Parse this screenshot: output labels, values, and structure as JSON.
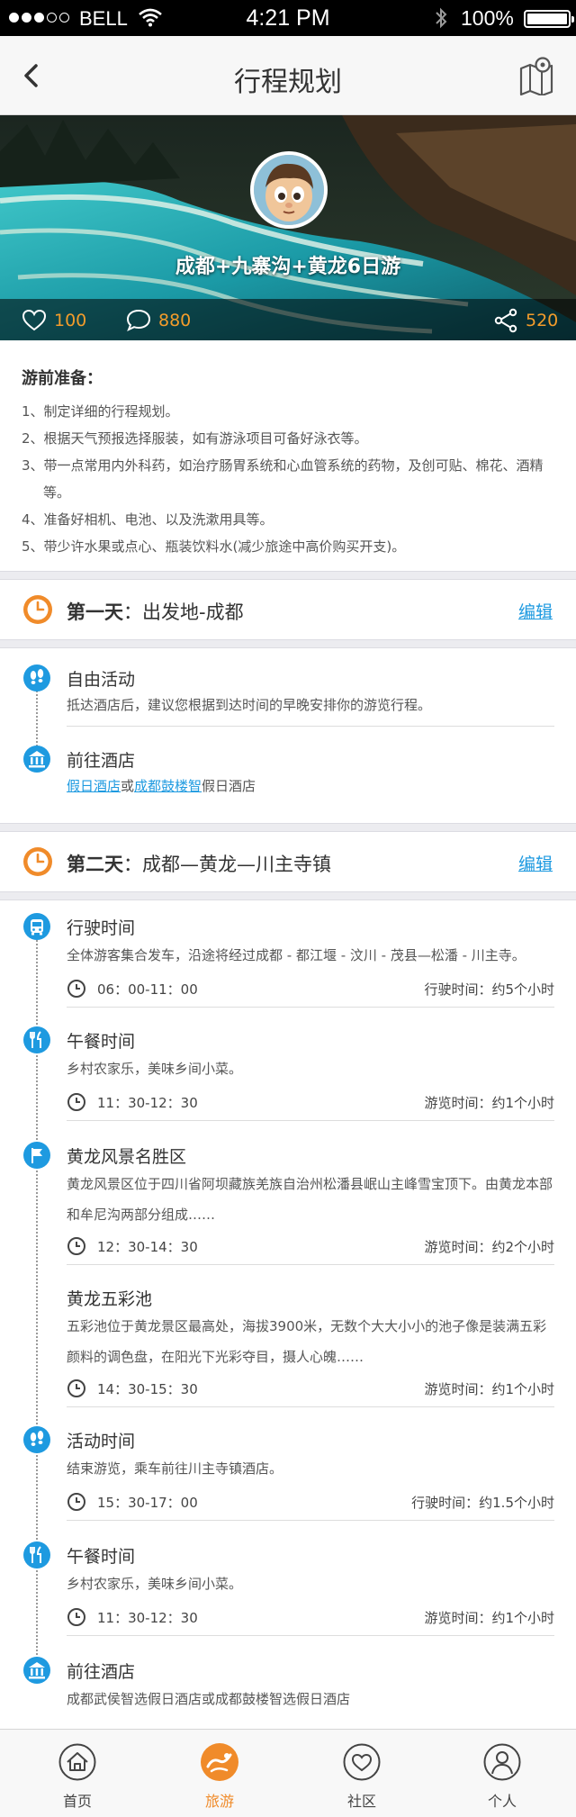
{
  "status_bar": {
    "carrier": "BELL",
    "time": "4:21 PM",
    "battery": "100%"
  },
  "nav": {
    "title": "行程规划",
    "back_icon": "chevron-left-icon",
    "map_icon": "map-pin-icon"
  },
  "hero": {
    "title": "成都+九寨沟+黄龙6日游",
    "likes": "100",
    "comments": "880",
    "shares": "520"
  },
  "prep": {
    "title": "游前准备：",
    "items": [
      "1、制定详细的行程规划。",
      "2、根据天气预报选择服装，如有游泳项目可备好泳衣等。",
      "3、带一点常用内外科药，如治疗肠胃系统和心血管系统的药物，及创可贴、棉花、酒精等。",
      "4、准备好相机、电池、以及洗漱用具等。",
      "5、带少许水果或点心、瓶装饮料水(减少旅途中高价购买开支)。"
    ]
  },
  "days": [
    {
      "label": "第一天",
      "route": "出发地-成都",
      "edit": "编辑",
      "items": [
        {
          "title": "自由活动",
          "desc": "抵达酒店后，建议您根据到达时间的早晚安排你的游览行程。"
        },
        {
          "title": "前往酒店",
          "link1": "假日酒店",
          "or": "或",
          "link2": "成都鼓楼智",
          "suffix": "假日酒店"
        }
      ]
    },
    {
      "label": "第二天",
      "route": "成都—黄龙—川主寺镇",
      "edit": "编辑",
      "items": [
        {
          "title": "行驶时间",
          "desc": "全体游客集合发车，沿途将经过成都 - 都江堰 - 汶川 - 茂县—松潘 - 川主寺。",
          "time": "06：00-11：00",
          "duration": "行驶时间：约5个小时"
        },
        {
          "title": "午餐时间",
          "desc": "乡村农家乐，美味乡间小菜。",
          "time": "11：30-12：30",
          "duration": "游览时间：约1个小时"
        },
        {
          "title": "黄龙风景名胜区",
          "desc": "黄龙风景区位于四川省阿坝藏族羌族自治州松潘县岷山主峰雪宝顶下。由黄龙本部和牟尼沟两部分组成……",
          "time": "12：30-14：30",
          "duration": "游览时间：约2个小时"
        },
        {
          "title": "黄龙五彩池",
          "desc": "五彩池位于黄龙景区最高处，海拔3900米，无数个大大小小的池子像是装满五彩颜料的调色盘，在阳光下光彩夺目，摄人心魄……",
          "time": "14：30-15：30",
          "duration": "游览时间：约1个小时"
        },
        {
          "title": "活动时间",
          "desc": "结束游览，乘车前往川主寺镇酒店。",
          "time": "15：30-17：00",
          "duration": "行驶时间：约1.5个小时"
        },
        {
          "title": "午餐时间",
          "desc": "乡村农家乐，美味乡间小菜。",
          "time": "11：30-12：30",
          "duration": "游览时间：约1个小时"
        },
        {
          "title": "前往酒店",
          "desc": "成都武侯智选假日酒店或成都鼓楼智选假日酒店"
        }
      ]
    }
  ],
  "tabs": [
    {
      "label": "首页",
      "icon": "home-icon"
    },
    {
      "label": "旅游",
      "icon": "travel-icon"
    },
    {
      "label": "社区",
      "icon": "community-icon"
    },
    {
      "label": "个人",
      "icon": "user-icon"
    }
  ],
  "colors": {
    "accent": "#1e9ae0",
    "orange": "#f08b2a",
    "stat": "#f39c2b"
  }
}
